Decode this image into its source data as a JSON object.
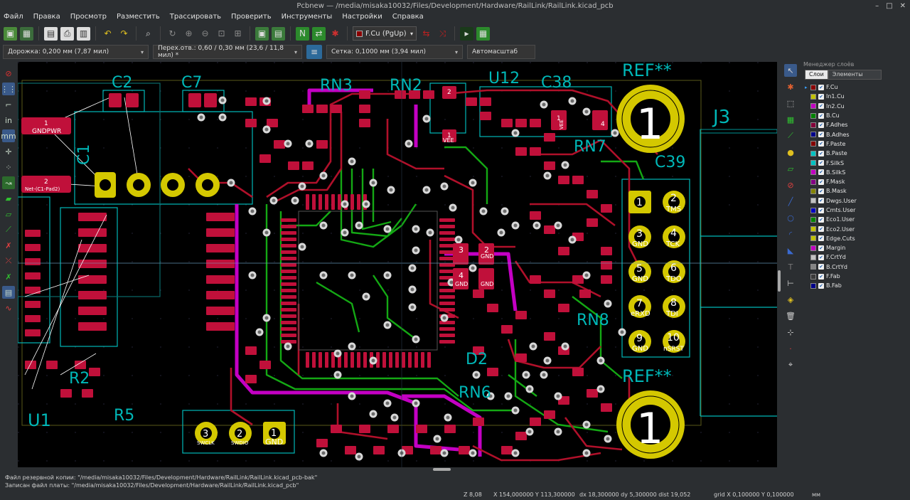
{
  "window": {
    "title": "Pcbnew — /media/misaka10032/Files/Development/Hardware/RailLink/RailLink.kicad_pcb",
    "controls": [
      "–",
      "□",
      "✕"
    ]
  },
  "menu": [
    "Файл",
    "Правка",
    "Просмотр",
    "Разместить",
    "Трассировать",
    "Проверить",
    "Инструменты",
    "Настройки",
    "Справка"
  ],
  "toolbar": {
    "layer_select": "F.Cu (PgUp)",
    "active_layer_color": "#8b0000"
  },
  "options_bar": {
    "track": "Дорожка: 0,200 мм (7,87 мил)",
    "via": "Перех.отв.: 0,60 / 0,30 мм (23,6 / 11,8 мил) *",
    "grid": "Сетка: 0,1000 мм (3,94 мил)",
    "zoom": "Автомасштаб"
  },
  "board": {
    "ref_labels": [
      "C2",
      "C7",
      "RN3",
      "RN2",
      "U12",
      "C38",
      "REF**",
      "J3",
      "C39",
      "RN7",
      "U1",
      "R2",
      "R5",
      "D2",
      "RN6",
      "RN8",
      "C1",
      "REF**"
    ],
    "pad_labels": [
      "1",
      "2",
      "3",
      "4",
      "5",
      "6",
      "7",
      "8",
      "9",
      "10"
    ],
    "pad_nets": [
      "TMS",
      "GND",
      "TCK",
      "GND",
      "TDO",
      "eRXD",
      "TDI",
      "GND",
      "nSRST"
    ],
    "bottom_header": [
      "3",
      "2",
      "1"
    ],
    "bottom_header_nets": [
      "SWCLK",
      "SWDIO",
      "GND"
    ],
    "pwr_labels": [
      "GNDPWR",
      "Net-(C1-Pad2)",
      "VEE",
      "VEE"
    ],
    "mounting_hole": "1",
    "small_labels": [
      "1",
      "2",
      "2",
      "1",
      "3",
      "2",
      "4",
      "GND",
      "GND",
      "GND"
    ]
  },
  "layers_panel": {
    "title": "Менеджер слоёв",
    "tabs": [
      "Слои",
      "Элементы"
    ],
    "layers": [
      {
        "name": "F.Cu",
        "color": "#8b0000",
        "active": true
      },
      {
        "name": "In1.Cu",
        "color": "#c2c200",
        "active": false
      },
      {
        "name": "In2.Cu",
        "color": "#c200c2",
        "active": false
      },
      {
        "name": "B.Cu",
        "color": "#008400",
        "active": false
      },
      {
        "name": "F.Adhes",
        "color": "#84003a",
        "active": false
      },
      {
        "name": "B.Adhes",
        "color": "#00008b",
        "active": false
      },
      {
        "name": "F.Paste",
        "color": "#840000",
        "active": false
      },
      {
        "name": "B.Paste",
        "color": "#00c2c2",
        "active": false
      },
      {
        "name": "F.SilkS",
        "color": "#00c2c2",
        "active": false
      },
      {
        "name": "B.SilkS",
        "color": "#c200c2",
        "active": false
      },
      {
        "name": "F.Mask",
        "color": "#840084",
        "active": false
      },
      {
        "name": "B.Mask",
        "color": "#848400",
        "active": false
      },
      {
        "name": "Dwgs.User",
        "color": "#c2c2c2",
        "active": false
      },
      {
        "name": "Cmts.User",
        "color": "#0000c2",
        "active": false
      },
      {
        "name": "Eco1.User",
        "color": "#008400",
        "active": false
      },
      {
        "name": "Eco2.User",
        "color": "#c2c200",
        "active": false
      },
      {
        "name": "Edge.Cuts",
        "color": "#c2c200",
        "active": false
      },
      {
        "name": "Margin",
        "color": "#c200c2",
        "active": false
      },
      {
        "name": "F.CrtYd",
        "color": "#c2c2c2",
        "active": false
      },
      {
        "name": "B.CrtYd",
        "color": "#848484",
        "active": false
      },
      {
        "name": "F.Fab",
        "color": "#3a3a3a",
        "active": false
      },
      {
        "name": "B.Fab",
        "color": "#00008b",
        "active": false
      }
    ]
  },
  "status": {
    "line1": "Файл резервной копии: \"/media/misaka10032/Files/Development/Hardware/RailLink/RailLink.kicad_pcb-bak\"",
    "line2": "Записан файл платы: \"/media/misaka10032/Files/Development/Hardware/RailLink/RailLink.kicad_pcb\"",
    "zoom": "Z 8,08",
    "xy": "X 154,000000  Y 113,300000",
    "delta": "dx 18,300000  dy 5,300000  dist 19,052",
    "grid": "grid X 0,100000  Y 0,100000",
    "units": "мм"
  },
  "colors": {
    "fcu": "#b0102a",
    "bcu": "#14a814",
    "margin": "#c400c4",
    "silk": "#00bcbc",
    "edge": "#d8d800",
    "pad_gold": "#d4c800",
    "background": "#000000"
  }
}
